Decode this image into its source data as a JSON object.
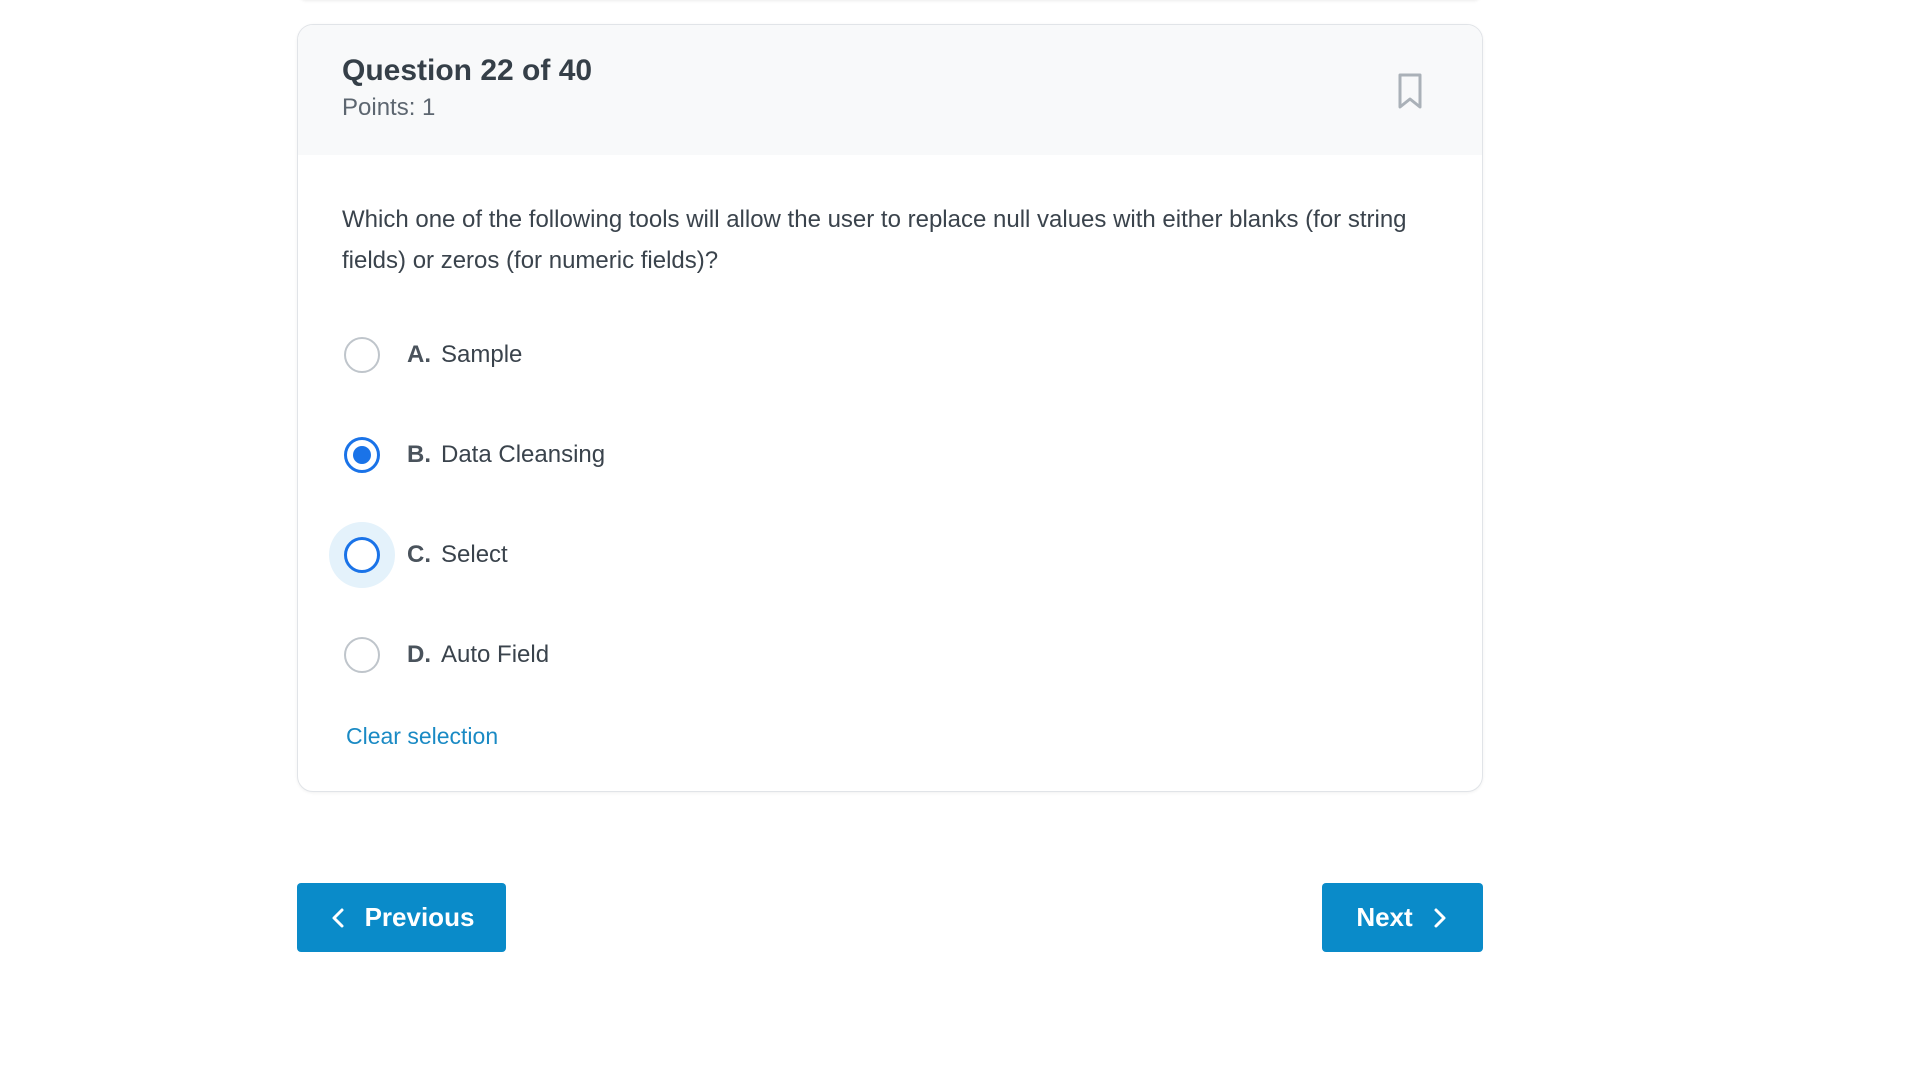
{
  "question": {
    "title": "Question 22 of 40",
    "points": "Points: 1",
    "text": "Which one of the following tools will allow the user to replace null values with either blanks (for string fields) or zeros (for numeric fields)?",
    "bookmark_icon": "bookmark-icon"
  },
  "options": [
    {
      "letter": "A.",
      "label": "Sample",
      "state": "unselected"
    },
    {
      "letter": "B.",
      "label": "Data Cleansing",
      "state": "selected"
    },
    {
      "letter": "C.",
      "label": "Select",
      "state": "hover"
    },
    {
      "letter": "D.",
      "label": "Auto Field",
      "state": "unselected"
    }
  ],
  "clear_label": "Clear selection",
  "nav": {
    "previous_label": "Previous",
    "next_label": "Next",
    "previous_icon": "chevron-left-icon",
    "next_icon": "chevron-right-icon"
  },
  "colors": {
    "accent": "#0a8bc9",
    "radio_selected": "#1a73e8",
    "link": "#1a8ac4"
  }
}
